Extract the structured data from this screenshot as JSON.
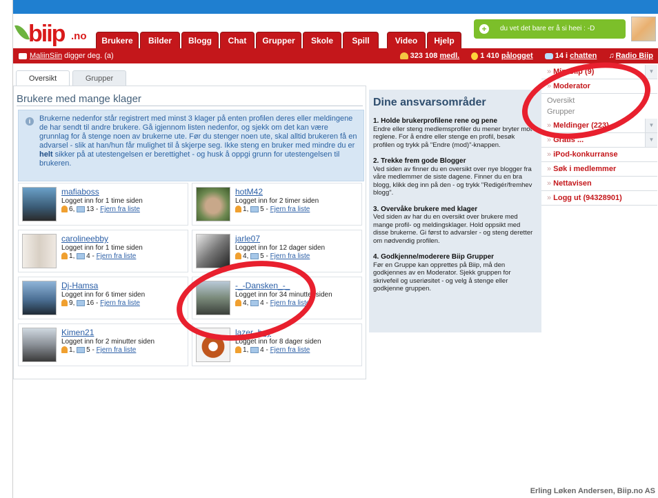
{
  "header": {
    "logo_word": "biip",
    "logo_tld": ".no",
    "tabs": [
      "Brukere",
      "Bilder",
      "Blogg",
      "Chat",
      "Grupper",
      "Skole",
      "Spill",
      "Video",
      "Hjelp"
    ],
    "promo_text": "du vet det bare er å si heei : -D"
  },
  "statusbar": {
    "user": "MaliinSiin",
    "action": " digger deg. (a)",
    "members_count": "323 108",
    "members_label": "medl.",
    "online_count": "1 410",
    "online_label": "pålogget",
    "chat_count": "14 i",
    "chat_label": "chatten",
    "radio_label": "Radio Biip"
  },
  "subtabs": [
    "Oversikt",
    "Grupper"
  ],
  "main": {
    "title": "Brukere med mange klager",
    "info_part1": "Brukerne nedenfor står registrert med minst 3 klager på enten profilen deres eller meldingene de har sendt til andre brukere. Gå igjennom listen nedenfor, og sjekk om det kan være grunnlag for å stenge noen av brukerne ute. Før du stenger noen ute, skal alltid brukeren få en advarsel - slik at han/hun får mulighet til å skjerpe seg. Ikke steng en bruker med mindre du er ",
    "info_bold": "helt",
    "info_part2": " sikker på at utestengelsen er berettighet - og husk å oppgi grunn for utestengelsen til brukeren.",
    "remove_label": "Fjern fra liste",
    "users": [
      {
        "name": "mafiaboss",
        "seen": "Logget inn for 1 time siden",
        "profile": "6",
        "msgs": "13"
      },
      {
        "name": "hotM42",
        "seen": "Logget inn for 2 timer siden",
        "profile": "1",
        "msgs": "5"
      },
      {
        "name": "carolineebby",
        "seen": "Logget inn for 1 time siden",
        "profile": "1",
        "msgs": "4"
      },
      {
        "name": "jarle07",
        "seen": "Logget inn for 12 dager siden",
        "profile": "4",
        "msgs": "5"
      },
      {
        "name": "Dj-Hamsa",
        "seen": "Logget inn for 6 timer siden",
        "profile": "9",
        "msgs": "16"
      },
      {
        "name": "-_-Dansken_-_",
        "seen": "Logget inn for 34 minutter siden",
        "profile": "4",
        "msgs": "4"
      },
      {
        "name": "Kimen21",
        "seen": "Logget inn for 2 minutter siden",
        "profile": "1",
        "msgs": "5"
      },
      {
        "name": "lazer_boy",
        "seen": "Logget inn for 8 dager siden",
        "profile": "1",
        "msgs": "4"
      }
    ]
  },
  "responsibilities": {
    "title": "Dine ansvarsområder",
    "sections": [
      {
        "heading": "1. Holde brukerprofilene rene og pene",
        "text": "Endre eller steng medlemsprofiler du mener bryter mot reglene. For å endre eller stenge en profil, besøk profilen og trykk på \"Endre (mod)\"-knappen."
      },
      {
        "heading": "2. Trekke frem gode Blogger",
        "text": "Ved siden av finner du en oversikt over nye blogger fra våre medlemmer de siste dagene. Finner du en bra blogg, klikk deg inn på den - og trykk \"Redigér/fremhev blogg\"."
      },
      {
        "heading": "3. Overvåke brukere med klager",
        "text": "Ved siden av har du en oversikt over brukere med mange profil- og meldingsklager. Hold oppsikt med disse brukerne. Gi først to advarsler - og steng deretter om nødvendig profilen."
      },
      {
        "heading": "4. Godkjenne/moderere Biip Grupper",
        "text": "Før en Gruppe kan opprettes på Biip, må den godkjennes av en Moderator. Sjekk gruppen for skrivefeil og useriøsitet - og velg å stenge eller godkjenne gruppen."
      }
    ]
  },
  "sidebar": {
    "items": [
      {
        "label": "Min Biip (9)"
      },
      {
        "label": "Moderator"
      },
      {
        "label": "Meldinger (223)"
      },
      {
        "label": "Gratis ..."
      },
      {
        "label": "iPod-konkurranse"
      },
      {
        "label": "Søk i medlemmer"
      },
      {
        "label": "Nettavisen"
      },
      {
        "label": "Logg ut (94328901)"
      }
    ],
    "moderator_sub": [
      "Oversikt",
      "Grupper"
    ]
  },
  "footer": "Erling Løken Andersen, Biip.no AS",
  "colors": {
    "brand_red": "#c4171b",
    "top_blue": "#1f7fd0",
    "highlight_circle": "#e8202e",
    "promo_green": "#7cbf2a"
  }
}
